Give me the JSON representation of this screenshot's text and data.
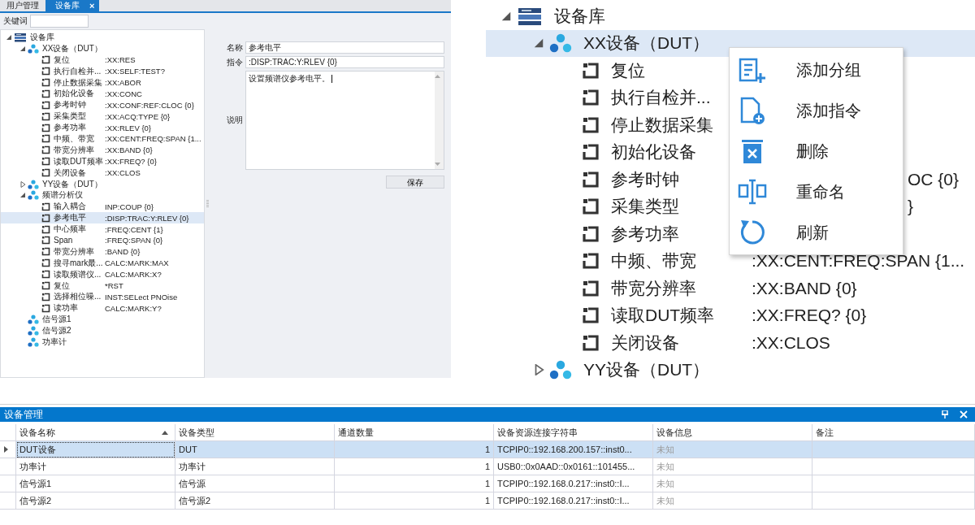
{
  "left_panel": {
    "tabs": [
      {
        "label": "用户管理",
        "selected": false
      },
      {
        "label": "设备库",
        "selected": true,
        "close": "×"
      }
    ],
    "keyword_label": "关键词",
    "tree": [
      {
        "label": "设备库",
        "kind": "root",
        "expanded": true,
        "selected": false,
        "children": [
          {
            "label": "XX设备（DUT）",
            "kind": "device",
            "expanded": true,
            "selected": false,
            "children": [
              {
                "label": "复位",
                "kind": "command",
                "command": ":XX:RES",
                "selected": false
              },
              {
                "label": "执行自检并...",
                "kind": "command",
                "command": ":XX:SELF:TEST?",
                "selected": false
              },
              {
                "label": "停止数据采集",
                "kind": "command",
                "command": ":XX:ABOR",
                "selected": false
              },
              {
                "label": "初始化设备",
                "kind": "command",
                "command": ":XX:CONC",
                "selected": false
              },
              {
                "label": "参考时钟",
                "kind": "command",
                "command": ":XX:CONF:REF:CLOC {0}",
                "selected": false
              },
              {
                "label": "采集类型",
                "kind": "command",
                "command": ":XX:ACQ:TYPE {0}",
                "selected": false
              },
              {
                "label": "参考功率",
                "kind": "command",
                "command": ":XX:RLEV {0}",
                "selected": false
              },
              {
                "label": "中频、带宽",
                "kind": "command",
                "command": ":XX:CENT:FREQ:SPAN {1...",
                "selected": false
              },
              {
                "label": "带宽分辨率",
                "kind": "command",
                "command": ":XX:BAND {0}",
                "selected": false
              },
              {
                "label": "读取DUT频率",
                "kind": "command",
                "command": ":XX:FREQ? {0}",
                "selected": false
              },
              {
                "label": "关闭设备",
                "kind": "command",
                "command": ":XX:CLOS",
                "selected": false
              }
            ]
          },
          {
            "label": "YY设备（DUT）",
            "kind": "device",
            "expanded": false,
            "selected": false
          },
          {
            "label": "频谱分析仪",
            "kind": "device",
            "expanded": true,
            "selected": false,
            "children": [
              {
                "label": "输入耦合",
                "kind": "command",
                "command": "INP:COUP {0}",
                "selected": false
              },
              {
                "label": "参考电平",
                "kind": "command",
                "command": ":DISP:TRAC:Y:RLEV {0}",
                "selected": true
              },
              {
                "label": "中心频率",
                "kind": "command",
                "command": ":FREQ:CENT {1}",
                "selected": false
              },
              {
                "label": "Span",
                "kind": "command",
                "command": ":FREQ:SPAN {0}",
                "selected": false
              },
              {
                "label": "带宽分辨率",
                "kind": "command",
                "command": ":BAND {0}",
                "selected": false
              },
              {
                "label": "搜寻mark最...",
                "kind": "command",
                "command": "CALC:MARK:MAX",
                "selected": false
              },
              {
                "label": "读取频谱仪...",
                "kind": "command",
                "command": "CALC:MARK:X?",
                "selected": false
              },
              {
                "label": "复位",
                "kind": "command",
                "command": "*RST",
                "selected": false
              },
              {
                "label": "选择相位噪...",
                "kind": "command",
                "command": "INST:SELect PNOise",
                "selected": false
              },
              {
                "label": "读功率",
                "kind": "command",
                "command": "CALC:MARK:Y?",
                "selected": false
              }
            ]
          },
          {
            "label": "信号源1",
            "kind": "device",
            "selected": false
          },
          {
            "label": "信号源2",
            "kind": "device",
            "selected": false
          },
          {
            "label": "功率计",
            "kind": "device",
            "selected": false
          }
        ]
      }
    ],
    "form": {
      "name_label": "名称",
      "name_value": "参考电平",
      "command_label": "指令",
      "command_value": ":DISP:TRAC:Y:RLEV {0}",
      "description_label": "说明",
      "description_value": "设置频谱仪参考电平。",
      "save_button": "保存"
    }
  },
  "zoom_view": {
    "tree": [
      {
        "label": "设备库",
        "kind": "root",
        "expanded": true,
        "selected": false,
        "children": [
          {
            "label": "XX设备（DUT）",
            "kind": "device",
            "expanded": true,
            "selected": true,
            "children": [
              {
                "label": "复位",
                "kind": "command",
                "selected": false
              },
              {
                "label": "执行自检并...",
                "kind": "command",
                "selected": false
              },
              {
                "label": "停止数据采集",
                "kind": "command",
                "selected": false
              },
              {
                "label": "初始化设备",
                "kind": "command",
                "selected": false
              },
              {
                "label": "参考时钟",
                "kind": "command",
                "command_partial": "OC {0}",
                "selected": false
              },
              {
                "label": "采集类型",
                "kind": "command",
                "command_partial": "}",
                "selected": false
              },
              {
                "label": "参考功率",
                "kind": "command",
                "selected": false
              },
              {
                "label": "中频、带宽",
                "kind": "command",
                "command": ":XX:CENT:FREQ:SPAN {1...",
                "selected": false
              },
              {
                "label": "带宽分辨率",
                "kind": "command",
                "command": ":XX:BAND {0}",
                "selected": false
              },
              {
                "label": "读取DUT频率",
                "kind": "command",
                "command": ":XX:FREQ? {0}",
                "selected": false
              },
              {
                "label": "关闭设备",
                "kind": "command",
                "command": ":XX:CLOS",
                "selected": false
              }
            ]
          },
          {
            "label": "YY设备（DUT）",
            "kind": "device",
            "expanded": false,
            "selected": false
          }
        ]
      }
    ],
    "context_menu": [
      {
        "label": "添加分组",
        "kind": "add-group"
      },
      {
        "label": "添加指令",
        "kind": "add-command"
      },
      {
        "label": "删除",
        "kind": "delete"
      },
      {
        "label": "重命名",
        "kind": "rename"
      },
      {
        "label": "刷新",
        "kind": "refresh"
      }
    ]
  },
  "device_panel": {
    "title": "设备管理",
    "columns": [
      {
        "label": "设备名称",
        "kind": "text",
        "sorted": true
      },
      {
        "label": "设备类型",
        "kind": "text",
        "sorted": false
      },
      {
        "label": "通道数量",
        "kind": "number",
        "sorted": false
      },
      {
        "label": "设备资源连接字符串",
        "kind": "text",
        "sorted": false
      },
      {
        "label": "设备信息",
        "kind": "muted",
        "sorted": false
      },
      {
        "label": "备注",
        "kind": "text",
        "sorted": false
      }
    ],
    "rows": [
      {
        "selected": true,
        "cells": [
          "DUT设备",
          "DUT",
          "1",
          "TCPIP0::192.168.200.157::inst0...",
          "未知",
          ""
        ]
      },
      {
        "selected": false,
        "cells": [
          "功率计",
          "功率计",
          "1",
          "USB0::0x0AAD::0x0161::101455...",
          "未知",
          ""
        ]
      },
      {
        "selected": false,
        "cells": [
          "信号源1",
          "信号源",
          "1",
          "TCPIP0::192.168.0.217::inst0::I...",
          "未知",
          ""
        ]
      },
      {
        "selected": false,
        "cells": [
          "信号源2",
          "信号源2",
          "1",
          "TCPIP0::192.168.0.217::inst0::I...",
          "未知",
          ""
        ]
      }
    ]
  }
}
